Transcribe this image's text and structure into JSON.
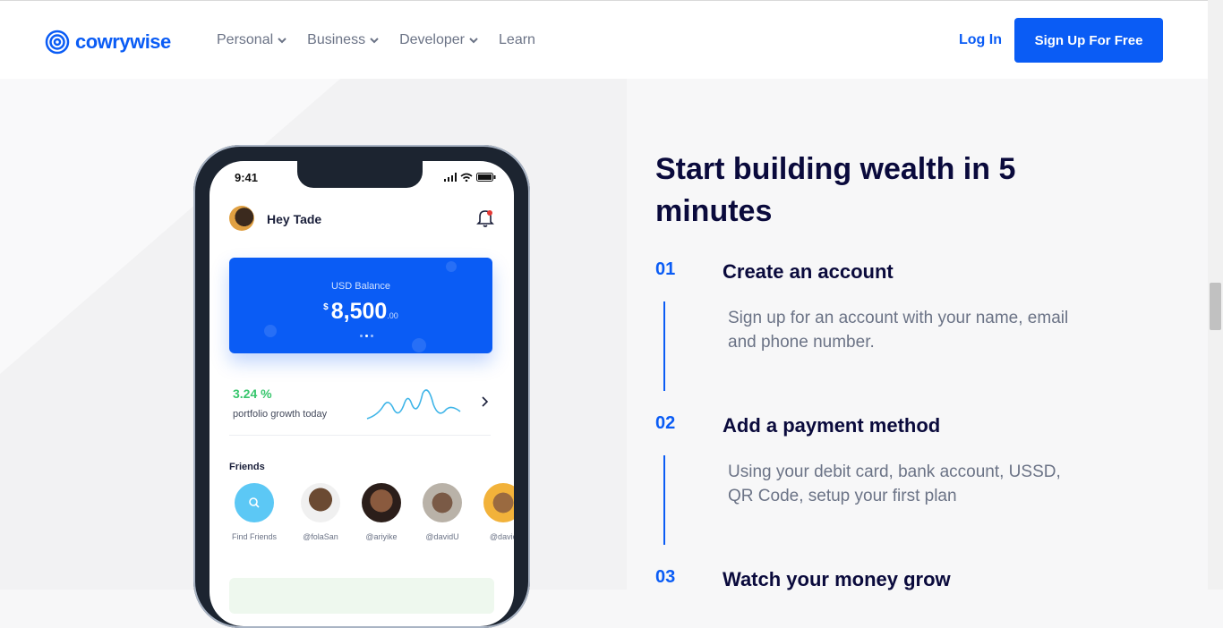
{
  "brand": {
    "name": "cowrywise",
    "color": "#0a5cf5"
  },
  "nav": [
    {
      "label": "Personal",
      "has_dropdown": true
    },
    {
      "label": "Business",
      "has_dropdown": true
    },
    {
      "label": "Developer",
      "has_dropdown": true
    },
    {
      "label": "Learn",
      "has_dropdown": false
    }
  ],
  "header": {
    "login_label": "Log In",
    "signup_label": "Sign Up For Free"
  },
  "phone": {
    "time": "9:41",
    "greeting": "Hey Tade",
    "balance_label": "USD Balance",
    "balance_currency": "$",
    "balance_amount": "8,500",
    "balance_cents": ".00",
    "growth_value": "3.24 %",
    "growth_label": "portfolio growth today",
    "friends_title": "Friends",
    "friends": [
      {
        "name": "Find Friends",
        "icon": "search-icon"
      },
      {
        "name": "@folaSan"
      },
      {
        "name": "@ariyike"
      },
      {
        "name": "@davidU"
      },
      {
        "name": "@davic"
      }
    ]
  },
  "content": {
    "headline": "Start building wealth in 5 minutes",
    "steps": [
      {
        "num": "01",
        "title": "Create an account",
        "desc": "Sign up for an account with your name, email and phone number."
      },
      {
        "num": "02",
        "title": "Add a payment method",
        "desc": "Using your debit card, bank account, USSD, QR Code, setup your first plan"
      },
      {
        "num": "03",
        "title": "Watch your money grow",
        "desc": ""
      }
    ]
  }
}
